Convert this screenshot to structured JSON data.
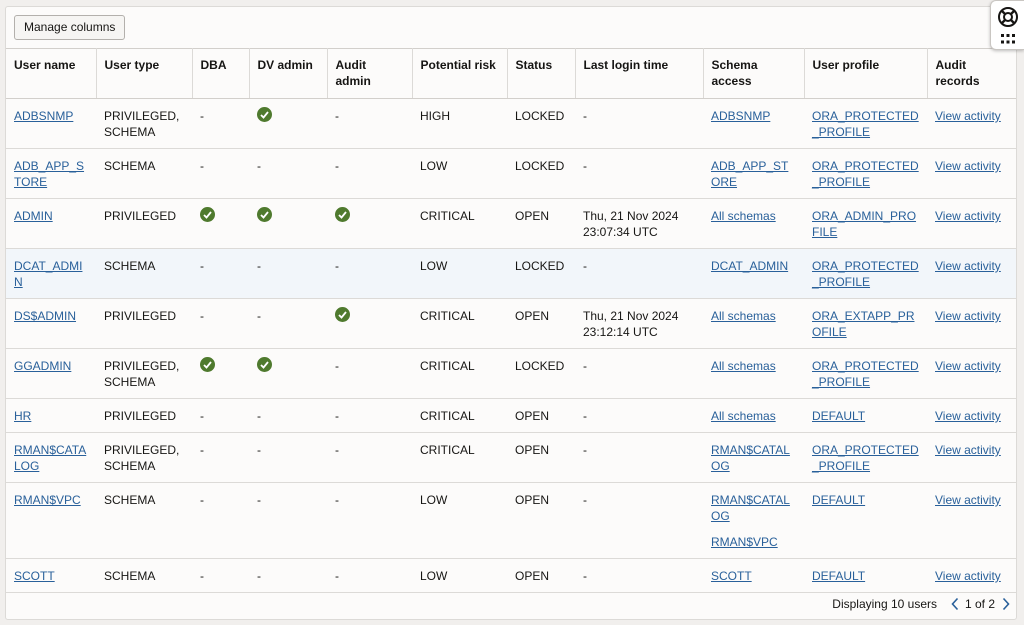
{
  "toolbar": {
    "manage_columns_label": "Manage columns"
  },
  "columns": {
    "user_name": "User name",
    "user_type": "User type",
    "dba": "DBA",
    "dv_admin": "DV admin",
    "audit_admin": "Audit admin",
    "potential_risk": "Potential risk",
    "status": "Status",
    "last_login": "Last login time",
    "schema_access": "Schema access",
    "user_profile": "User profile",
    "audit_records": "Audit records"
  },
  "rows": [
    {
      "user": "ADBSNMP",
      "type": "PRIVILEGED, SCHEMA",
      "dba": "-",
      "dv": "check",
      "audit": "-",
      "risk": "HIGH",
      "status": "LOCKED",
      "login": "-",
      "schema": [
        "ADBSNMP"
      ],
      "profile": "ORA_PROTECTED_PROFILE",
      "audit_link": "View activity"
    },
    {
      "user": "ADB_APP_STORE",
      "type": "SCHEMA",
      "dba": "-",
      "dv": "-",
      "audit": "-",
      "risk": "LOW",
      "status": "LOCKED",
      "login": "-",
      "schema": [
        "ADB_APP_STORE"
      ],
      "profile": "ORA_PROTECTED_PROFILE",
      "audit_link": "View activity"
    },
    {
      "user": "ADMIN",
      "type": "PRIVILEGED",
      "dba": "check",
      "dv": "check",
      "audit": "check",
      "risk": "CRITICAL",
      "status": "OPEN",
      "login": "Thu, 21 Nov 2024 23:07:34 UTC",
      "schema": [
        "All schemas"
      ],
      "profile": "ORA_ADMIN_PROFILE",
      "audit_link": "View activity"
    },
    {
      "user": "DCAT_ADMIN",
      "type": "SCHEMA",
      "dba": "-",
      "dv": "-",
      "audit": "-",
      "risk": "LOW",
      "status": "LOCKED",
      "login": "-",
      "schema": [
        "DCAT_ADMIN"
      ],
      "profile": "ORA_PROTECTED_PROFILE",
      "audit_link": "View activity"
    },
    {
      "user": "DS$ADMIN",
      "type": "PRIVILEGED",
      "dba": "-",
      "dv": "-",
      "audit": "check",
      "risk": "CRITICAL",
      "status": "OPEN",
      "login": "Thu, 21 Nov 2024 23:12:14 UTC",
      "schema": [
        "All schemas"
      ],
      "profile": "ORA_EXTAPP_PROFILE",
      "audit_link": "View activity"
    },
    {
      "user": "GGADMIN",
      "type": "PRIVILEGED, SCHEMA",
      "dba": "check",
      "dv": "check",
      "audit": "-",
      "risk": "CRITICAL",
      "status": "LOCKED",
      "login": "-",
      "schema": [
        "All schemas"
      ],
      "profile": "ORA_PROTECTED_PROFILE",
      "audit_link": "View activity"
    },
    {
      "user": "HR",
      "type": "PRIVILEGED",
      "dba": "-",
      "dv": "-",
      "audit": "-",
      "risk": "CRITICAL",
      "status": "OPEN",
      "login": "-",
      "schema": [
        "All schemas"
      ],
      "profile": "DEFAULT",
      "audit_link": "View activity"
    },
    {
      "user": "RMAN$CATALOG",
      "type": "PRIVILEGED, SCHEMA",
      "dba": "-",
      "dv": "-",
      "audit": "-",
      "risk": "CRITICAL",
      "status": "OPEN",
      "login": "-",
      "schema": [
        "RMAN$CATALOG"
      ],
      "profile": "ORA_PROTECTED_PROFILE",
      "audit_link": "View activity"
    },
    {
      "user": "RMAN$VPC",
      "type": "SCHEMA",
      "dba": "-",
      "dv": "-",
      "audit": "-",
      "risk": "LOW",
      "status": "OPEN",
      "login": "-",
      "schema": [
        "RMAN$CATALOG",
        "RMAN$VPC"
      ],
      "profile": "DEFAULT",
      "audit_link": "View activity"
    },
    {
      "user": "SCOTT",
      "type": "SCHEMA",
      "dba": "-",
      "dv": "-",
      "audit": "-",
      "risk": "LOW",
      "status": "OPEN",
      "login": "-",
      "schema": [
        "SCOTT"
      ],
      "profile": "DEFAULT",
      "audit_link": "View activity"
    }
  ],
  "footer": {
    "count_text": "Displaying 10 users",
    "page_text": "1 of 2"
  },
  "icons": {
    "check": "check-circle-icon",
    "prev": "chevron-left-icon",
    "next": "chevron-right-icon",
    "help": "lifebuoy-icon",
    "apps": "grid-dots-icon"
  },
  "colors": {
    "link": "#29609a",
    "check": "#4f7a2e",
    "row_highlight": "#f2f6fa"
  }
}
